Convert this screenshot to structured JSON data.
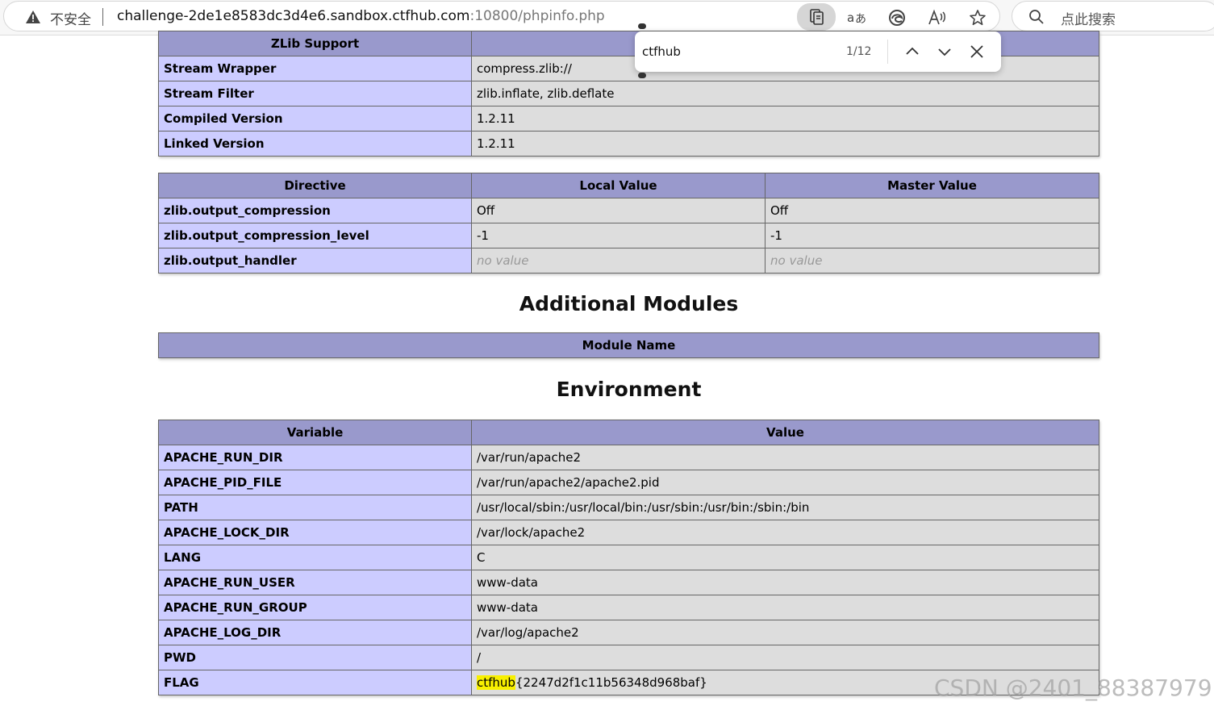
{
  "browser": {
    "security_label": "不安全",
    "url_main": "challenge-2de1e8583dc3d4e6.sandbox.ctfhub.com",
    "url_port_path": ":10800/phpinfo.php",
    "search_placeholder": "点此搜索",
    "icons": [
      "warning-icon",
      "page-tools-icon",
      "translate-icon",
      "edge-icon",
      "read-aloud-icon",
      "favorite-star-icon",
      "search-icon"
    ]
  },
  "find": {
    "query": "ctfhub",
    "count": "1/12"
  },
  "zlib": {
    "header": "ZLib Support",
    "rows": [
      {
        "name": "Stream Wrapper",
        "value": "compress.zlib://"
      },
      {
        "name": "Stream Filter",
        "value": "zlib.inflate, zlib.deflate"
      },
      {
        "name": "Compiled Version",
        "value": "1.2.11"
      },
      {
        "name": "Linked Version",
        "value": "1.2.11"
      }
    ]
  },
  "directives": {
    "headers": [
      "Directive",
      "Local Value",
      "Master Value"
    ],
    "rows": [
      {
        "name": "zlib.output_compression",
        "local": "Off",
        "master": "Off"
      },
      {
        "name": "zlib.output_compression_level",
        "local": "-1",
        "master": "-1"
      },
      {
        "name": "zlib.output_handler",
        "local": "no value",
        "master": "no value"
      }
    ]
  },
  "additional_modules": {
    "title": "Additional Modules",
    "header": "Module Name"
  },
  "environment": {
    "title": "Environment",
    "headers": [
      "Variable",
      "Value"
    ],
    "rows": [
      {
        "name": "APACHE_RUN_DIR",
        "value": "/var/run/apache2"
      },
      {
        "name": "APACHE_PID_FILE",
        "value": "/var/run/apache2/apache2.pid"
      },
      {
        "name": "PATH",
        "value": "/usr/local/sbin:/usr/local/bin:/usr/sbin:/usr/bin:/sbin:/bin"
      },
      {
        "name": "APACHE_LOCK_DIR",
        "value": "/var/lock/apache2"
      },
      {
        "name": "LANG",
        "value": "C"
      },
      {
        "name": "APACHE_RUN_USER",
        "value": "www-data"
      },
      {
        "name": "APACHE_RUN_GROUP",
        "value": "www-data"
      },
      {
        "name": "APACHE_LOG_DIR",
        "value": "/var/log/apache2"
      },
      {
        "name": "PWD",
        "value": "/"
      }
    ],
    "flag": {
      "name": "FLAG",
      "value_highlight": "ctfhub",
      "value_rest": "{2247d2f1c11b56348d968baf}"
    }
  },
  "watermark": "CSDN @2401_88387979",
  "colors": {
    "header_bg": "#9999cc",
    "name_bg": "#ccccff",
    "value_bg": "#dddddd",
    "highlight": "#f8f000"
  }
}
